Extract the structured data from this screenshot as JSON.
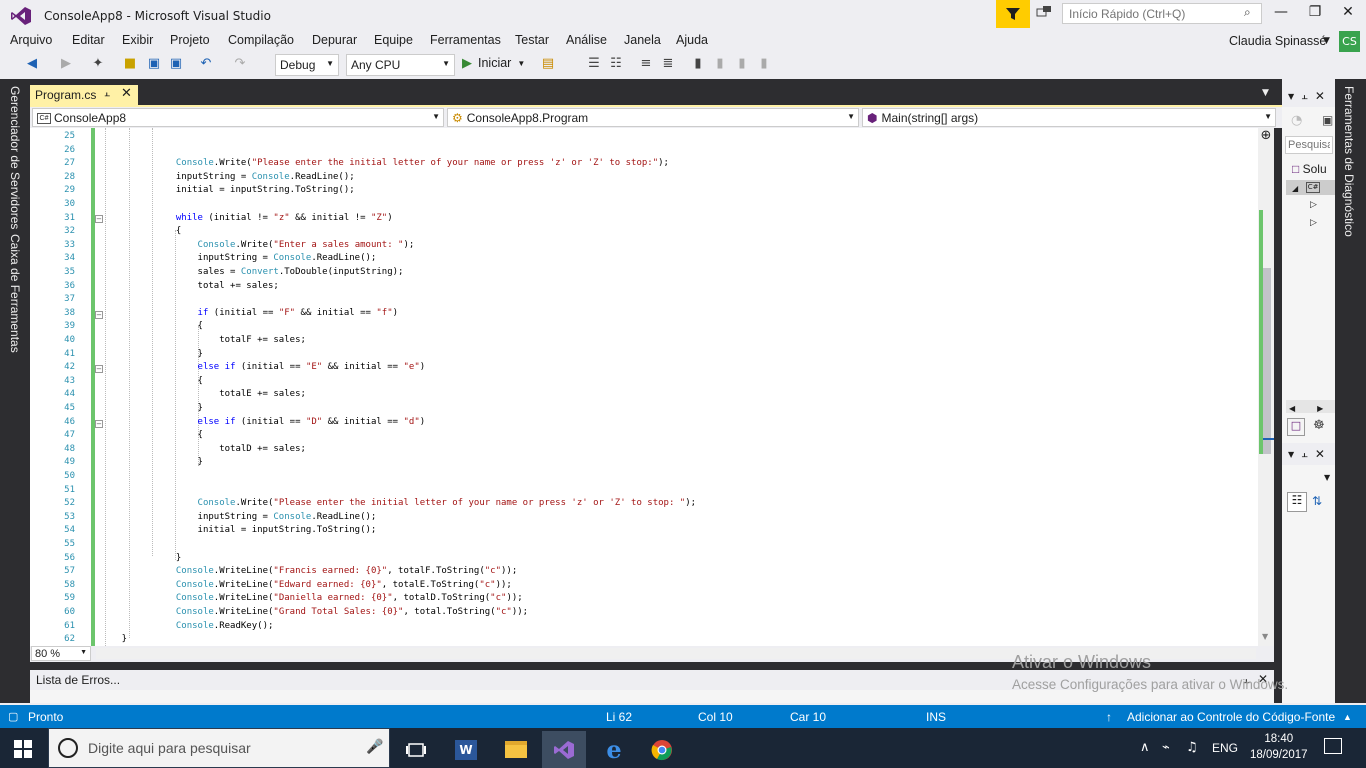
{
  "window": {
    "title": "ConsoleApp8 - Microsoft Visual Studio",
    "quick_launch_placeholder": "Início Rápido (Ctrl+Q)",
    "user_name": "Claudia Spinassé",
    "user_initials": "CS"
  },
  "menu": [
    "Arquivo",
    "Editar",
    "Exibir",
    "Projeto",
    "Compilação",
    "Depurar",
    "Equipe",
    "Ferramentas",
    "Testar",
    "Análise",
    "Janela",
    "Ajuda"
  ],
  "toolbar": {
    "configuration": "Debug",
    "platform": "Any CPU",
    "start_label": "Iniciar"
  },
  "side_tabs": {
    "left_1": "Gerenciador de Servidores",
    "left_2": "Caixa de Ferramentas",
    "right_1": "Ferramentas de Diagnóstico"
  },
  "document_tab": {
    "label": "Program.cs"
  },
  "navigation": {
    "project": "ConsoleApp8",
    "class": "ConsoleApp8.Program",
    "member": "Main(string[] args)"
  },
  "editor": {
    "zoom": "80 %",
    "line_numbers": [
      "25",
      "26",
      "27",
      "28",
      "29",
      "30",
      "31",
      "32",
      "33",
      "34",
      "35",
      "36",
      "37",
      "38",
      "39",
      "40",
      "41",
      "42",
      "43",
      "44",
      "45",
      "46",
      "47",
      "48",
      "49",
      "50",
      "51",
      "52",
      "53",
      "54",
      "55",
      "56",
      "57",
      "58",
      "59",
      "60",
      "61",
      "62"
    ],
    "lines": [
      {
        "n": "25",
        "t": ""
      },
      {
        "n": "26",
        "t": ""
      },
      {
        "n": "27",
        "t": "        Console.Write(\"Please enter the initial letter of your name or press 'z' or 'Z' to stop:\");"
      },
      {
        "n": "28",
        "t": "        inputString = Console.ReadLine();"
      },
      {
        "n": "29",
        "t": "        initial = inputString.ToString();"
      },
      {
        "n": "30",
        "t": ""
      },
      {
        "n": "31",
        "t": "        while (initial != \"z\" && initial != \"Z\")"
      },
      {
        "n": "32",
        "t": "        {"
      },
      {
        "n": "33",
        "t": "            Console.Write(\"Enter a sales amount: \");"
      },
      {
        "n": "34",
        "t": "            inputString = Console.ReadLine();"
      },
      {
        "n": "35",
        "t": "            sales = Convert.ToDouble(inputString);"
      },
      {
        "n": "36",
        "t": "            total += sales;"
      },
      {
        "n": "37",
        "t": ""
      },
      {
        "n": "38",
        "t": "            if (initial == \"F\" && initial == \"f\")"
      },
      {
        "n": "39",
        "t": "            {"
      },
      {
        "n": "40",
        "t": "                totalF += sales;"
      },
      {
        "n": "41",
        "t": "            }"
      },
      {
        "n": "42",
        "t": "            else if (initial == \"E\" && initial == \"e\")"
      },
      {
        "n": "43",
        "t": "            {"
      },
      {
        "n": "44",
        "t": "                totalE += sales;"
      },
      {
        "n": "45",
        "t": "            }"
      },
      {
        "n": "46",
        "t": "            else if (initial == \"D\" && initial == \"d\")"
      },
      {
        "n": "47",
        "t": "            {"
      },
      {
        "n": "48",
        "t": "                totalD += sales;"
      },
      {
        "n": "49",
        "t": "            }"
      },
      {
        "n": "50",
        "t": ""
      },
      {
        "n": "51",
        "t": ""
      },
      {
        "n": "52",
        "t": "            Console.Write(\"Please enter the initial letter of your name or press 'z' or 'Z' to stop: \");"
      },
      {
        "n": "53",
        "t": "            inputString = Console.ReadLine();"
      },
      {
        "n": "54",
        "t": "            initial = inputString.ToString();"
      },
      {
        "n": "55",
        "t": ""
      },
      {
        "n": "56",
        "t": "        }"
      },
      {
        "n": "57",
        "t": "        Console.WriteLine(\"Francis earned: {0}\", totalF.ToString(\"c\"));"
      },
      {
        "n": "58",
        "t": "        Console.WriteLine(\"Edward earned: {0}\", totalE.ToString(\"c\"));"
      },
      {
        "n": "59",
        "t": "        Console.WriteLine(\"Daniella earned: {0}\", totalD.ToString(\"c\"));"
      },
      {
        "n": "60",
        "t": "        Console.WriteLine(\"Grand Total Sales: {0}\", total.ToString(\"c\"));"
      },
      {
        "n": "61",
        "t": "        Console.ReadKey();"
      },
      {
        "n": "62",
        "t": "    }"
      }
    ]
  },
  "right_panel": {
    "search_placeholder": "Pesquisa",
    "solution_label": "Solu"
  },
  "error_panel": {
    "title": "Lista de Erros..."
  },
  "watermark": {
    "line1": "Ativar o Windows",
    "line2": "Acesse Configurações para ativar o Windows."
  },
  "statusbar": {
    "state": "Pronto",
    "line": "Li 62",
    "col": "Col 10",
    "car": "Car 10",
    "ins": "INS",
    "source_control": "Adicionar ao Controle do Código-Fonte"
  },
  "taskbar": {
    "search_placeholder": "Digite aqui para pesquisar",
    "language": "ENG",
    "time": "18:40",
    "date": "18/09/2017"
  },
  "colors": {
    "accent": "#007acc",
    "tab_active": "#fff1a6",
    "change_bar": "#6cc56c",
    "keyword": "#0000ff",
    "type": "#2b91af",
    "string": "#a31515"
  }
}
